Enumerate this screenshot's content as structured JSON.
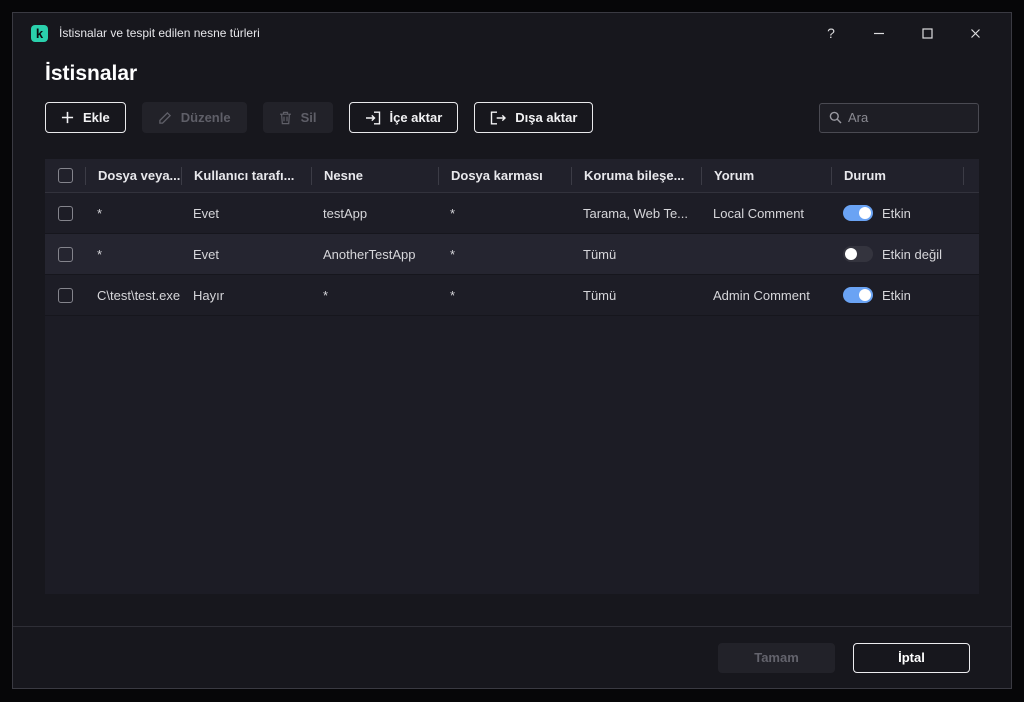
{
  "window": {
    "title": "İstisnalar ve tespit edilen nesne türleri",
    "help_glyph": "?"
  },
  "page": {
    "title": "İstisnalar"
  },
  "toolbar": {
    "add_label": "Ekle",
    "edit_label": "Düzenle",
    "delete_label": "Sil",
    "import_label": "İçe aktar",
    "export_label": "Dışa aktar",
    "search_placeholder": "Ara"
  },
  "table": {
    "columns": [
      "Dosya veya...",
      "Kullanıcı tarafı...",
      "Nesne",
      "Dosya karması",
      "Koruma bileşe...",
      "Yorum",
      "Durum"
    ],
    "rows": [
      {
        "file": "*",
        "user": "Evet",
        "object": "testApp",
        "hash": "*",
        "components": "Tarama, Web Te...",
        "comment": "Local Comment",
        "status": "Etkin",
        "enabled": true
      },
      {
        "file": "*",
        "user": "Evet",
        "object": "AnotherTestApp",
        "hash": "*",
        "components": "Tümü",
        "comment": "",
        "status": "Etkin değil",
        "enabled": false
      },
      {
        "file": "C\\test\\test.exe",
        "user": "Hayır",
        "object": "*",
        "hash": "*",
        "components": "Tümü",
        "comment": "Admin Comment",
        "status": "Etkin",
        "enabled": true
      }
    ]
  },
  "footer": {
    "ok_label": "Tamam",
    "cancel_label": "İptal"
  },
  "colors": {
    "brand": "#2ad0ac",
    "toggle_on": "#6aa3f4",
    "window_bg": "#17171d"
  }
}
